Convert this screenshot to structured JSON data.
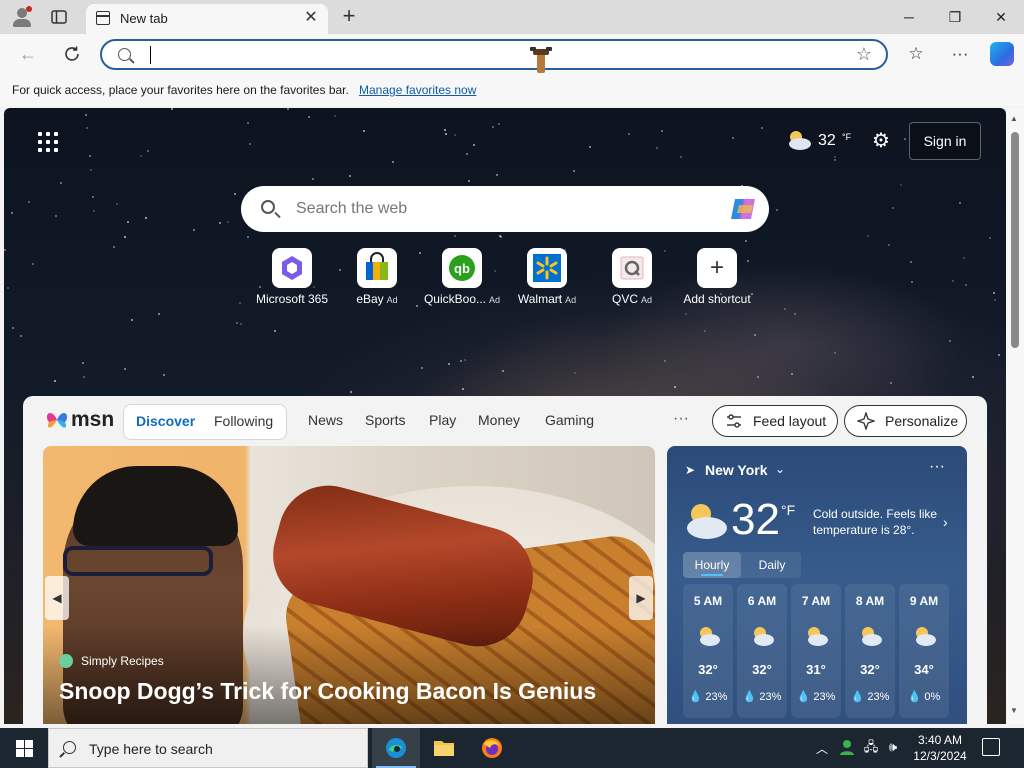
{
  "browser": {
    "tab_title": "New tab",
    "favorites_bar": {
      "message": "For quick access, place your favorites here on the favorites bar.",
      "link": "Manage favorites now"
    }
  },
  "page": {
    "weather_top": {
      "temp": "32",
      "unit": "°F"
    },
    "sign_in": "Sign in",
    "search_placeholder": "Search the web",
    "shortcuts": [
      {
        "label": "Microsoft 365",
        "ad": ""
      },
      {
        "label": "eBay",
        "ad": "Ad"
      },
      {
        "label": "QuickBoo...",
        "ad": "Ad"
      },
      {
        "label": "Walmart",
        "ad": "Ad"
      },
      {
        "label": "QVC",
        "ad": "Ad"
      },
      {
        "label": "Add shortcut",
        "ad": ""
      }
    ],
    "feed": {
      "logo": "msn",
      "tabs": [
        "Discover",
        "Following"
      ],
      "nav": [
        "News",
        "Sports",
        "Play",
        "Money",
        "Gaming"
      ],
      "more": "···",
      "feed_layout": "Feed layout",
      "personalize": "Personalize",
      "hero": {
        "source": "Simply Recipes",
        "headline": "Snoop Dogg’s Trick for Cooking Bacon Is Genius"
      },
      "weather": {
        "location": "New York",
        "temp": "32",
        "unit": "°F",
        "description": "Cold outside. Feels like temperature is 28°.",
        "tabs": [
          "Hourly",
          "Daily"
        ],
        "more": "···",
        "hourly": [
          {
            "time": "5 AM",
            "temp": "32°",
            "rain": "23%"
          },
          {
            "time": "6 AM",
            "temp": "32°",
            "rain": "23%"
          },
          {
            "time": "7 AM",
            "temp": "31°",
            "rain": "23%"
          },
          {
            "time": "8 AM",
            "temp": "32°",
            "rain": "23%"
          },
          {
            "time": "9 AM",
            "temp": "34°",
            "rain": "0%"
          }
        ]
      }
    }
  },
  "taskbar": {
    "search_placeholder": "Type here to search",
    "time": "3:40 AM",
    "date": "12/3/2024"
  },
  "colors": {
    "accent": "#2a5f9e",
    "link": "#0f5ca8",
    "feed_active_tab": "#0f6cbd"
  }
}
